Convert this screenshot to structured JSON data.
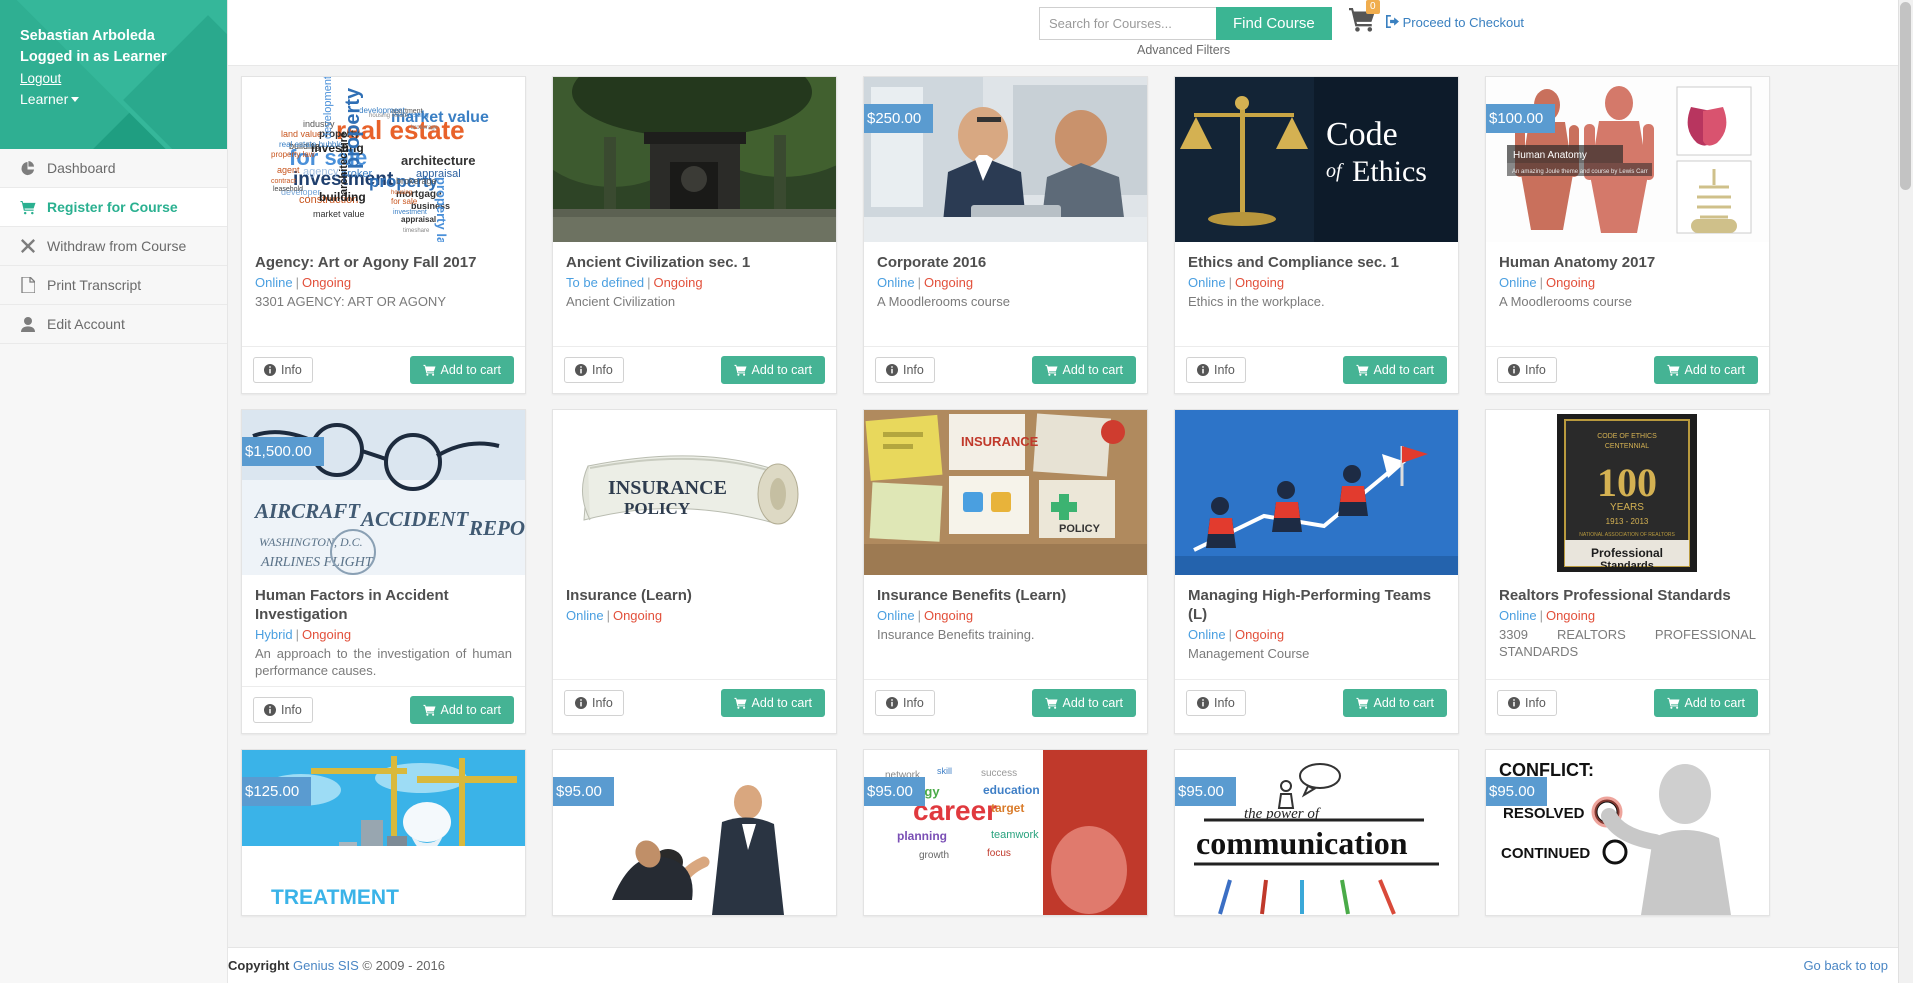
{
  "sidebar": {
    "user_name": "Sebastian Arboleda",
    "role_line": "Logged in as Learner",
    "logout_label": "Logout",
    "role_switch_label": "Learner",
    "items": [
      {
        "label": "Dashboard",
        "icon": "pie-chart-icon",
        "active": false
      },
      {
        "label": "Register for Course",
        "icon": "cart-icon",
        "active": true
      },
      {
        "label": "Withdraw from Course",
        "icon": "close-x-icon",
        "active": false
      },
      {
        "label": "Print Transcript",
        "icon": "pdf-file-icon",
        "active": false
      },
      {
        "label": "Edit Account",
        "icon": "user-icon",
        "active": false
      }
    ]
  },
  "topbar": {
    "search_placeholder": "Search for Courses...",
    "search_value": "",
    "find_course_label": "Find Course",
    "advanced_filters_label": "Advanced Filters",
    "cart_count": "0",
    "checkout_label": "Proceed to Checkout"
  },
  "buttons": {
    "info_label": "Info",
    "add_to_cart_label": "Add to cart"
  },
  "courses": [
    {
      "title": "Agency: Art or Agony Fall 2017",
      "mode": "Online",
      "status": "Ongoing",
      "description": "3301 AGENCY: ART OR AGONY",
      "price": "",
      "thumb": "word-cloud-real-estate"
    },
    {
      "title": "Ancient Civilization sec. 1",
      "mode": "To be defined",
      "status": "Ongoing",
      "description": "Ancient Civilization",
      "price": "",
      "thumb": "temple-gate-photo"
    },
    {
      "title": "Corporate 2016",
      "mode": "Online",
      "status": "Ongoing",
      "description": "A Moodlerooms course",
      "price": "$250.00",
      "thumb": "businessmen-meeting-photo"
    },
    {
      "title": "Ethics and Compliance sec. 1",
      "mode": "Online",
      "status": "Ongoing",
      "description": "Ethics in the workplace.",
      "price": "",
      "thumb": "code-of-ethics-scales"
    },
    {
      "title": "Human Anatomy 2017",
      "mode": "Online",
      "status": "Ongoing",
      "description": "A Moodlerooms course",
      "price": "$100.00",
      "thumb": "human-anatomy-diagram"
    },
    {
      "title": "Human Factors in Accident Investigation",
      "mode": "Hybrid",
      "status": "Ongoing",
      "description": "An approach to the investigation of human performance causes.",
      "price": "$1,500.00",
      "thumb": "aircraft-accident-report-glasses"
    },
    {
      "title": "Insurance (Learn)",
      "mode": "Online",
      "status": "Ongoing",
      "description": "",
      "price": "",
      "thumb": "insurance-policy-scroll"
    },
    {
      "title": "Insurance Benefits (Learn)",
      "mode": "Online",
      "status": "Ongoing",
      "description": "Insurance Benefits training.",
      "price": "",
      "thumb": "insurance-sticky-notes"
    },
    {
      "title": "Managing High-Performing Teams (L)",
      "mode": "Online",
      "status": "Ongoing",
      "description": "Management Course",
      "price": "",
      "thumb": "team-climbing-chart"
    },
    {
      "title": "Realtors Professional Standards",
      "mode": "Online",
      "status": "Ongoing",
      "description": "3309 REALTORS PROFESSIONAL STANDARDS",
      "price": "",
      "thumb": "realtors-centennial-seal"
    }
  ],
  "courses_partial": [
    {
      "price": "$125.00",
      "thumb": "better-treatment-plan-crane"
    },
    {
      "price": "$95.00",
      "thumb": "business-bow-photo"
    },
    {
      "price": "$95.00",
      "thumb": "career-word-collage"
    },
    {
      "price": "$95.00",
      "thumb": "power-of-communication"
    },
    {
      "price": "$95.00",
      "thumb": "conflict-resolved-figure"
    }
  ],
  "footer": {
    "copyright_bold": "Copyright",
    "copyright_brand": "Genius SIS",
    "copyright_rest": "© 2009 - 2016",
    "back_to_top_label": "Go back to top"
  },
  "colors": {
    "brand_green": "#2ab090",
    "button_green": "#45b394",
    "price_blue": "#5a9bd0",
    "link_blue": "#4a86c4",
    "status_red": "#e2503b",
    "badge_orange": "#f0ad4e"
  }
}
